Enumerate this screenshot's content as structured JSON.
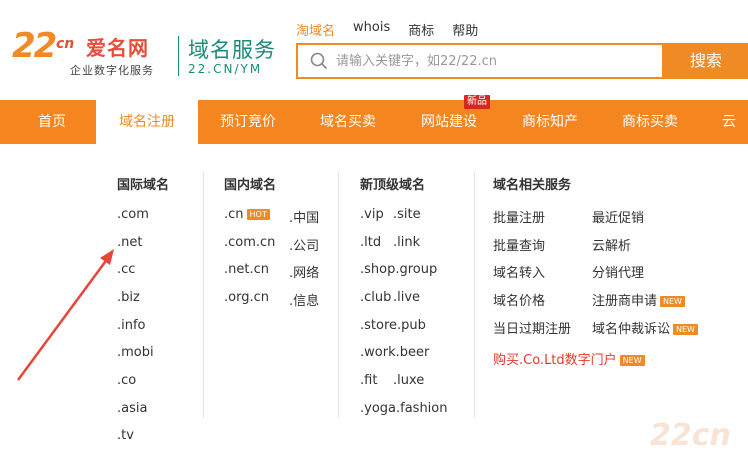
{
  "header": {
    "logo_number": "22",
    "logo_cn": "cn",
    "logo_brand": "爱名网",
    "logo_tagline": "企业数字化服务",
    "service_title": "域名服务",
    "service_subtitle": "22.CN/YM"
  },
  "search": {
    "tabs": [
      "淘域名",
      "whois",
      "商标",
      "帮助"
    ],
    "active_tab": 0,
    "placeholder": "请输入关键字，如22/22.cn",
    "button_label": "搜索"
  },
  "nav": {
    "items": [
      "首页",
      "域名注册",
      "预订竞价",
      "域名买卖",
      "网站建设",
      "商标知产",
      "商标买卖",
      "云"
    ],
    "active": 1,
    "badge": "新品"
  },
  "dropdown": {
    "intl": {
      "title": "国际域名",
      "items": [
        ".com",
        ".net",
        ".cc",
        ".biz",
        ".info",
        ".mobi",
        ".co",
        ".asia",
        ".tv"
      ]
    },
    "domestic": {
      "title": "国内域名",
      "left": [
        ".cn",
        ".com.cn",
        ".net.cn",
        ".org.cn"
      ],
      "right": [
        ".中国",
        ".公司",
        ".网络",
        ".信息"
      ],
      "cn_tag": "HOT"
    },
    "newtld": {
      "title": "新顶级域名",
      "rows": [
        [
          ".vip",
          ".site"
        ],
        [
          ".ltd",
          ".link"
        ],
        [
          ".shop.group"
        ],
        [
          ".club",
          ".live"
        ],
        [
          ".store.pub"
        ],
        [
          ".work.beer"
        ],
        [
          ".fit",
          ".luxe"
        ],
        [
          ".yoga.fashion"
        ]
      ]
    },
    "services": {
      "title": "域名相关服务",
      "left": [
        "批量注册",
        "批量查询",
        "域名转入",
        "域名价格",
        "当日过期注册"
      ],
      "right": [
        "最近促销",
        "云解析",
        "分销代理",
        "注册商申请",
        "域名仲裁诉讼"
      ],
      "new_tag": "NEW",
      "highlight": "购买.Co.Ltd数字门户"
    }
  },
  "watermark": "22cn",
  "colors": {
    "accent": "#f5851f",
    "teal": "#1a8a7a",
    "red": "#e83828"
  }
}
